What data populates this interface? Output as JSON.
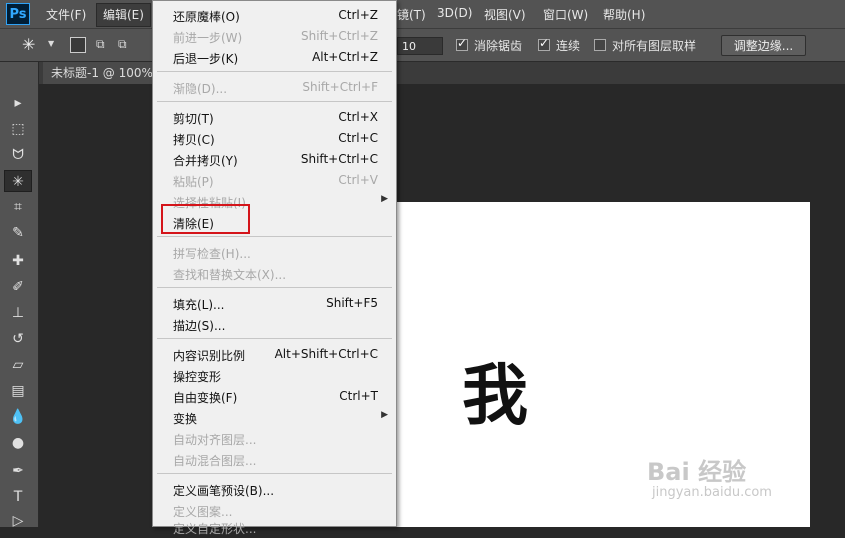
{
  "app": {
    "logo": "Ps"
  },
  "menubar": {
    "items": [
      "文件(F)",
      "编辑(E)",
      "镜(T)",
      "3D(D)",
      "视图(V)",
      "窗口(W)",
      "帮助(H)"
    ]
  },
  "options": {
    "tolerance_value": "10",
    "antialias_label": "消除锯齿",
    "contiguous_label": "连续",
    "all_layers_label": "对所有图层取样",
    "refine_edge_label": "调整边缘..."
  },
  "document": {
    "tab_title": "未标题-1 @ 100%"
  },
  "canvas": {
    "glyph": "我",
    "watermark": "Bai 经验",
    "watermark_sub": "jingyan.baidu.com"
  },
  "edit_menu": {
    "items": [
      {
        "label": "还原魔棒(O)",
        "shortcut": "Ctrl+Z"
      },
      {
        "label": "前进一步(W)",
        "shortcut": "Shift+Ctrl+Z"
      },
      {
        "label": "后退一步(K)",
        "shortcut": "Alt+Ctrl+Z"
      },
      {
        "label": "渐隐(D)...",
        "shortcut": "Shift+Ctrl+F"
      },
      {
        "label": "剪切(T)",
        "shortcut": "Ctrl+X"
      },
      {
        "label": "拷贝(C)",
        "shortcut": "Ctrl+C"
      },
      {
        "label": "合并拷贝(Y)",
        "shortcut": "Shift+Ctrl+C"
      },
      {
        "label": "粘贴(P)",
        "shortcut": "Ctrl+V"
      },
      {
        "label": "选择性粘贴(I)",
        "shortcut": ""
      },
      {
        "label": "清除(E)",
        "shortcut": ""
      },
      {
        "label": "拼写检查(H)...",
        "shortcut": ""
      },
      {
        "label": "查找和替换文本(X)...",
        "shortcut": ""
      },
      {
        "label": "填充(L)...",
        "shortcut": "Shift+F5"
      },
      {
        "label": "描边(S)...",
        "shortcut": ""
      },
      {
        "label": "内容识别比例",
        "shortcut": "Alt+Shift+Ctrl+C"
      },
      {
        "label": "操控变形",
        "shortcut": ""
      },
      {
        "label": "自由变换(F)",
        "shortcut": "Ctrl+T"
      },
      {
        "label": "变换",
        "shortcut": ""
      },
      {
        "label": "自动对齐图层...",
        "shortcut": ""
      },
      {
        "label": "自动混合图层...",
        "shortcut": ""
      },
      {
        "label": "定义画笔预设(B)...",
        "shortcut": ""
      },
      {
        "label": "定义图案...",
        "shortcut": ""
      },
      {
        "label": "定义自定形状...",
        "shortcut": ""
      }
    ]
  },
  "colors": {
    "highlight": "#d4141a",
    "ui_dark": "#535353"
  }
}
